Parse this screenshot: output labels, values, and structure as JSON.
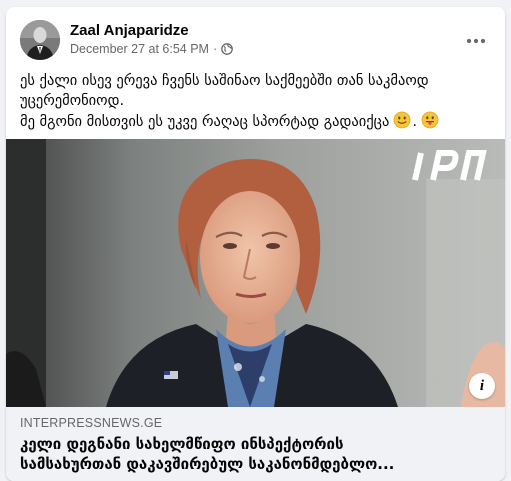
{
  "post": {
    "author": "Zaal Anjaparidze",
    "timestamp": "December 27 at 6:54 PM",
    "separator": "·",
    "privacy_icon": "globe-icon",
    "more_icon": "more-options-icon",
    "text_lines": [
      "ეს ქალი ისევ ერევა ჩვენს საშინაო საქმეებში თან საკმაოდ",
      "უცერემონიოდ.",
      "მე მგონი მისთვის ეს უკვე რაღაც სპორტად გადაიქცა"
    ],
    "emojis": [
      "slightly-smiling-face-icon",
      "face-with-tongue-icon"
    ]
  },
  "image": {
    "watermark": "IPN",
    "info_icon": "info-icon",
    "info_label": "i"
  },
  "link_preview": {
    "domain": "INTERPRESSNEWS.GE",
    "title_lines": [
      "კელი დეგნანი სახელმწიფო ინსპექტორის",
      "სამსახურთან დაკავშირებულ საკანონმდებლო..."
    ]
  },
  "colors": {
    "background": "#f0f2f5",
    "card": "#ffffff",
    "secondary_text": "#65676b",
    "primary_text": "#050505"
  }
}
